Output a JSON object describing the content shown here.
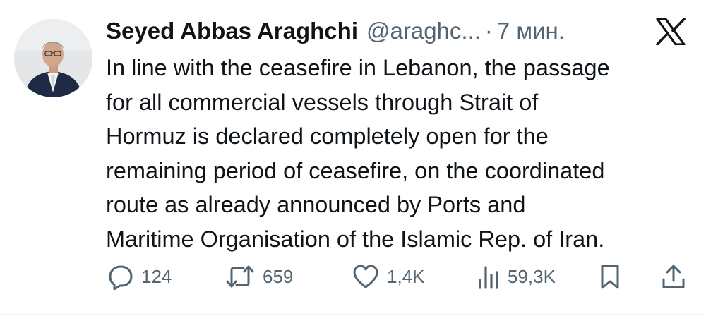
{
  "author": {
    "display_name": "Seyed Abbas Araghchi",
    "handle": "@araghc...",
    "separator": "·",
    "time": "7 мин."
  },
  "platform_logo": "x-logo-icon",
  "body_lines": [
    "In line with the ceasefire in Lebanon, the passage",
    "for all commercial vessels through Strait of",
    "Hormuz is declared completely open for the",
    "remaining period of ceasefire, on the coordinated",
    "route as already announced by Ports and",
    "Maritime Organisation of the Islamic Rep. of Iran."
  ],
  "actions": {
    "reply": {
      "icon": "reply-icon",
      "count": "124"
    },
    "repost": {
      "icon": "repost-icon",
      "count": "659"
    },
    "like": {
      "icon": "heart-icon",
      "count": "1,4K"
    },
    "views": {
      "icon": "views-icon",
      "count": "59,3K"
    },
    "bookmark": {
      "icon": "bookmark-icon"
    },
    "share": {
      "icon": "share-icon"
    }
  },
  "colors": {
    "text_primary": "#0f1419",
    "text_secondary": "#536471",
    "background": "#ffffff"
  }
}
